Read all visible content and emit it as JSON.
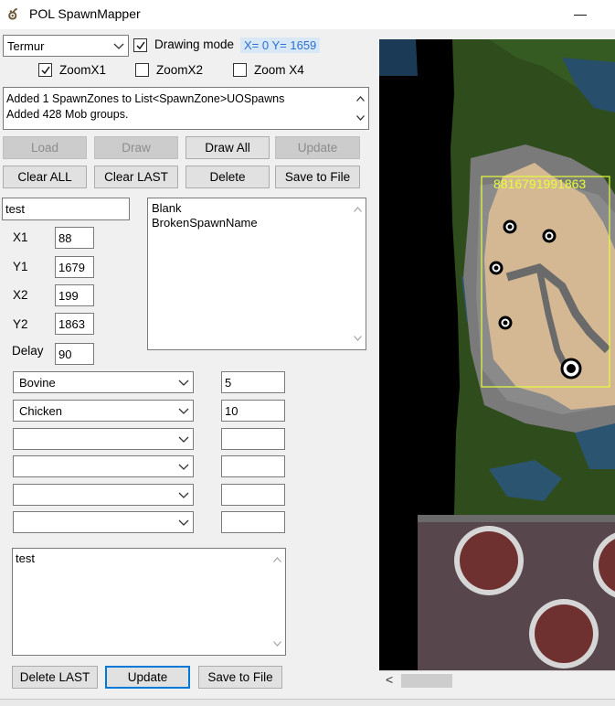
{
  "window": {
    "title": "POL SpawnMapper",
    "minimize_glyph": "—",
    "icon_glyph": "ఠ"
  },
  "top": {
    "region_select": "Termur",
    "drawing_mode_label": "Drawing mode",
    "drawing_mode_checked": true,
    "coords": "X= 0 Y= 1659"
  },
  "zoom": [
    {
      "label": "ZoomX1",
      "checked": true
    },
    {
      "label": "ZoomX2",
      "checked": false
    },
    {
      "label": "Zoom X4",
      "checked": false
    }
  ],
  "log": {
    "line1": "Added 1 SpawnZones to List<SpawnZone>UOSpawns",
    "line2": "Added 428 Mob groups."
  },
  "buttons": {
    "load": "Load",
    "draw": "Draw",
    "draw_all": "Draw All",
    "update_top": "Update",
    "clear_all": "Clear ALL",
    "clear_last": "Clear LAST",
    "delete": "Delete",
    "save_top": "Save to File",
    "delete_last": "Delete LAST",
    "update_bottom": "Update",
    "save_bottom": "Save to File"
  },
  "spawn": {
    "name": "test",
    "x1_label": "X1",
    "x1": "88",
    "y1_label": "Y1",
    "y1": "1679",
    "x2_label": "X2",
    "x2": "199",
    "y2_label": "Y2",
    "y2": "1863",
    "delay_label": "Delay",
    "delay": "90"
  },
  "spawn_list": [
    "Blank",
    "BrokenSpawnName"
  ],
  "mobs": [
    {
      "name": "Bovine",
      "count": "5"
    },
    {
      "name": "Chicken",
      "count": "10"
    },
    {
      "name": "",
      "count": ""
    },
    {
      "name": "",
      "count": ""
    },
    {
      "name": "",
      "count": ""
    },
    {
      "name": "",
      "count": ""
    }
  ],
  "notes": "test",
  "map": {
    "zone_label": "8816791991863",
    "zone_color": "#e6ff3a",
    "scroll_left_glyph": "<"
  }
}
